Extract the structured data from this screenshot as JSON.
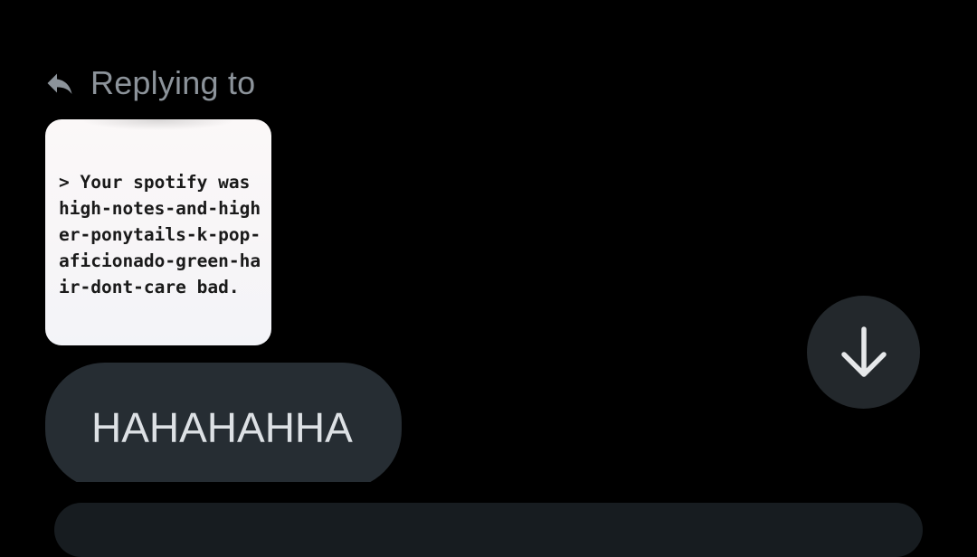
{
  "reply_header": {
    "label": "Replying to",
    "icon": "reply-arrow-icon",
    "color": "#8c939a"
  },
  "quoted_message": {
    "text": "> Your spotify was high-notes-and-higher-ponytails-k-pop-aficionado-green-hair-dont-care bad."
  },
  "message": {
    "text": "HAHAHAHHA",
    "bubble_color": "#262d33",
    "text_color": "#dde1e5"
  },
  "scroll_button": {
    "icon": "arrow-down-icon",
    "background": "#23282c"
  }
}
